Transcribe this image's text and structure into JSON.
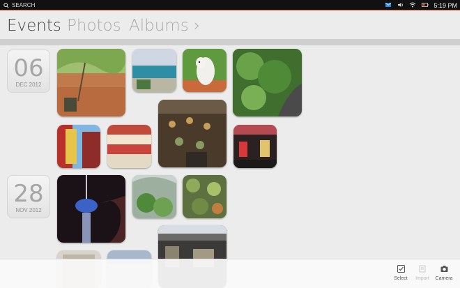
{
  "status_bar": {
    "search_label": "SEARCH",
    "time": "5:19 PM",
    "indicators": [
      "mail-icon",
      "volume-icon",
      "network-icon",
      "battery-icon"
    ],
    "accent_color": "#c8562b"
  },
  "tabs": [
    {
      "label": "Events",
      "active": true
    },
    {
      "label": "Photos",
      "active": false
    },
    {
      "label": "Albums ›",
      "active": false
    }
  ],
  "events": [
    {
      "day": "06",
      "month": "DEC 2012"
    },
    {
      "day": "28",
      "month": "NOV 2012"
    }
  ],
  "toolbar": {
    "select_label": "Select",
    "import_label": "Import",
    "camera_label": "Camera"
  }
}
